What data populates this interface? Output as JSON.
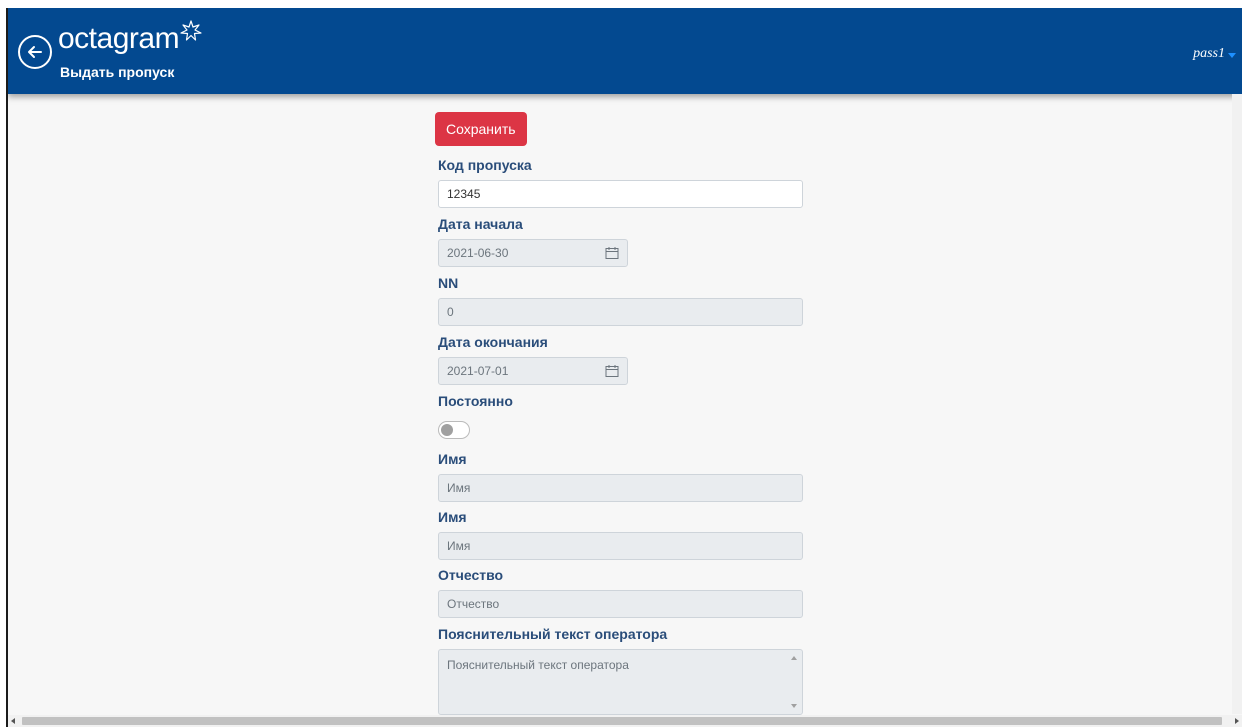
{
  "header": {
    "logo_text": "octagram",
    "subtitle": "Выдать пропуск",
    "user": "pass1"
  },
  "form": {
    "save_label": "Сохранить",
    "pass_code_label": "Код пропуска",
    "pass_code_value": "12345",
    "start_date_label": "Дата начала",
    "start_date_value": "2021-06-30",
    "nn_label": "NN",
    "nn_value": "0",
    "end_date_label": "Дата окончания",
    "end_date_value": "2021-07-01",
    "permanent_label": "Постоянно",
    "name1_label": "Имя",
    "name1_placeholder": "Имя",
    "name2_label": "Имя",
    "name2_placeholder": "Имя",
    "patronymic_label": "Отчество",
    "patronymic_placeholder": "Отчество",
    "operator_text_label": "Пояснительный текст оператора",
    "operator_text_placeholder": "Пояснительный текст оператора"
  },
  "colors": {
    "header_bg": "#034990",
    "save_button": "#dc3545",
    "label": "#2a4d7a"
  },
  "icons": [
    "back-arrow-icon",
    "star-icon",
    "caret-down-icon",
    "calendar-icon"
  ]
}
